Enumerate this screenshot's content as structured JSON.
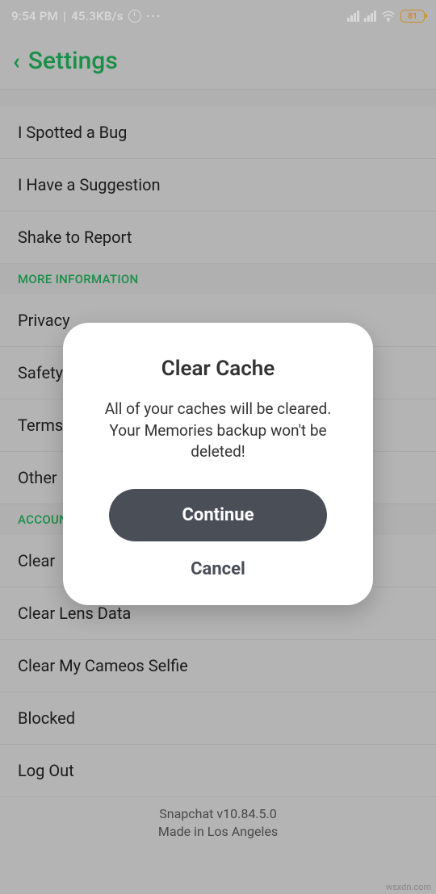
{
  "status": {
    "time": "9:54 PM",
    "speed": "45.3KB/s",
    "battery": "81"
  },
  "header": {
    "title": "Settings"
  },
  "sections": {
    "feedback": [
      "I Spotted a Bug",
      "I Have a Suggestion",
      "Shake to Report"
    ],
    "more_info_header": "MORE INFORMATION",
    "more_info": [
      "Privacy",
      "Safety",
      "Terms",
      "Other"
    ],
    "account_header": "ACCOUNT",
    "account": [
      "Clear",
      "Clear Lens Data",
      "Clear My Cameos Selfie",
      "Blocked",
      "Log Out"
    ]
  },
  "footer": {
    "line1": "Snapchat v10.84.5.0",
    "line2": "Made in Los Angeles"
  },
  "dialog": {
    "title": "Clear Cache",
    "body": "All of your caches will be cleared. Your Memories backup won't be deleted!",
    "continue": "Continue",
    "cancel": "Cancel"
  },
  "watermark": "wsxdn.com"
}
